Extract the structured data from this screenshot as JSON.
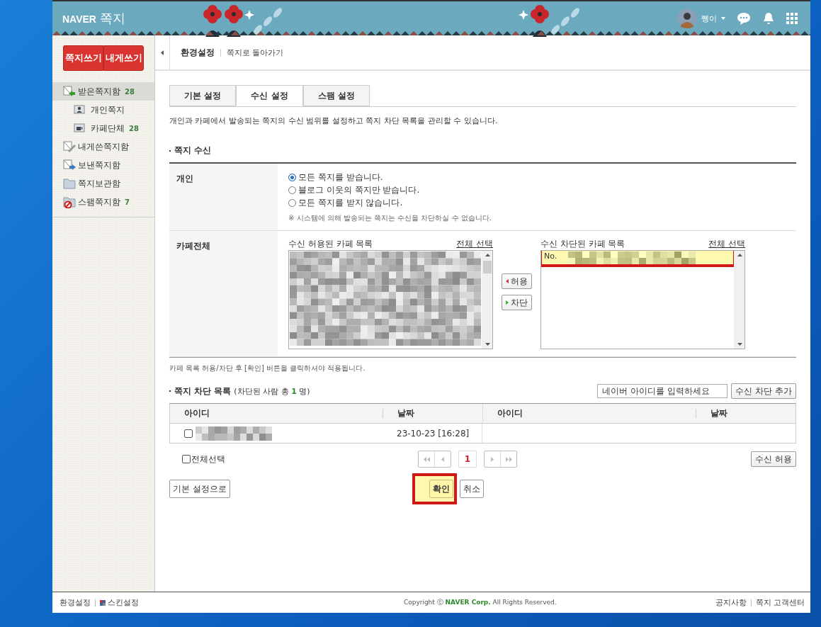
{
  "header": {
    "logo": "NAVER",
    "service": "쪽지",
    "user": "쩽이"
  },
  "sidebar": {
    "buttons": [
      "쪽지쓰기",
      "내게쓰기"
    ],
    "folders": [
      {
        "label": "받은쪽지함",
        "count": "28",
        "kind": "inbox",
        "selected": true,
        "children": [
          {
            "label": "개인쪽지",
            "kind": "person",
            "selected": false
          },
          {
            "label": "카페단체",
            "count": "28",
            "kind": "cup",
            "selected": false
          }
        ]
      },
      {
        "label": "내게쓴쪽지함",
        "kind": "pen",
        "selected": false
      },
      {
        "label": "보낸쪽지함",
        "kind": "sent",
        "selected": false
      },
      {
        "label": "쪽지보관함",
        "kind": "folder",
        "selected": false
      },
      {
        "label": "스팸쪽지함",
        "count": "7",
        "kind": "spam",
        "selected": false
      }
    ]
  },
  "topnav": {
    "title": "환경설정",
    "link": "쪽지로 돌아가기"
  },
  "tabs": [
    {
      "label": "기본 설정",
      "selected": false
    },
    {
      "label": "수신 설정",
      "selected": true
    },
    {
      "label": "스팸 설정",
      "selected": false
    }
  ],
  "description": "개인과 카페에서 발송되는 쪽지의 수신 범위를 설정하고 쪽지 차단 목록을 관리할 수 있습니다.",
  "receive": {
    "title": "쪽지 수신",
    "personal": {
      "label": "개인",
      "options": [
        {
          "label": "모든 쪽지를 받습니다.",
          "selected": true
        },
        {
          "label": "블로그 이웃의 쪽지만 받습니다.",
          "selected": false
        },
        {
          "label": "모든 쪽지를 받지 않습니다.",
          "selected": false
        }
      ],
      "note": "※ 시스템에 의해 발송되는 쪽지는 수신을 차단하실 수 없습니다."
    },
    "cafe": {
      "label": "카페전체",
      "allowed": {
        "title": "수신 허용된 카페 목록",
        "select_all": "전체 선택"
      },
      "move_buttons": [
        "허용",
        "차단"
      ],
      "blocked": {
        "title": "수신 차단된 카페 목록",
        "select_all": "전체 선택",
        "items": [
          {
            "text": "No.",
            "highlight": true
          }
        ]
      }
    },
    "footnote": "카페 목록 허용/차단 후 [확인] 버튼을 클릭하셔야 적용됩니다."
  },
  "blocklist": {
    "title": "쪽지 차단 목록",
    "summary": "(차단된 사람 총 **1** 명)",
    "input_placeholder": "네이버 아이디를 입력하세요",
    "add_button": "수신 차단 추가",
    "columns": [
      "아이디",
      "날짜",
      "아이디",
      "날짜"
    ],
    "rows": [
      {
        "checked": false,
        "date": "23-10-23 [16:28]"
      }
    ],
    "select_all": {
      "label": "전체선택",
      "checked": false
    },
    "page": "1",
    "allow_button": "수신 허용"
  },
  "actions": [
    {
      "label": "기본 설정으로",
      "kind": "reset"
    },
    {
      "label": "확인",
      "kind": "primary",
      "highlight": true
    },
    {
      "label": "취소",
      "kind": "cancel"
    }
  ],
  "footer": {
    "left": [
      "환경설정",
      "스킨설정"
    ],
    "copyright": "Copyright ⓒ **NAVER Corp.** All Rights Reserved.",
    "right": [
      "공지사항",
      "쪽지 고객센터"
    ]
  }
}
